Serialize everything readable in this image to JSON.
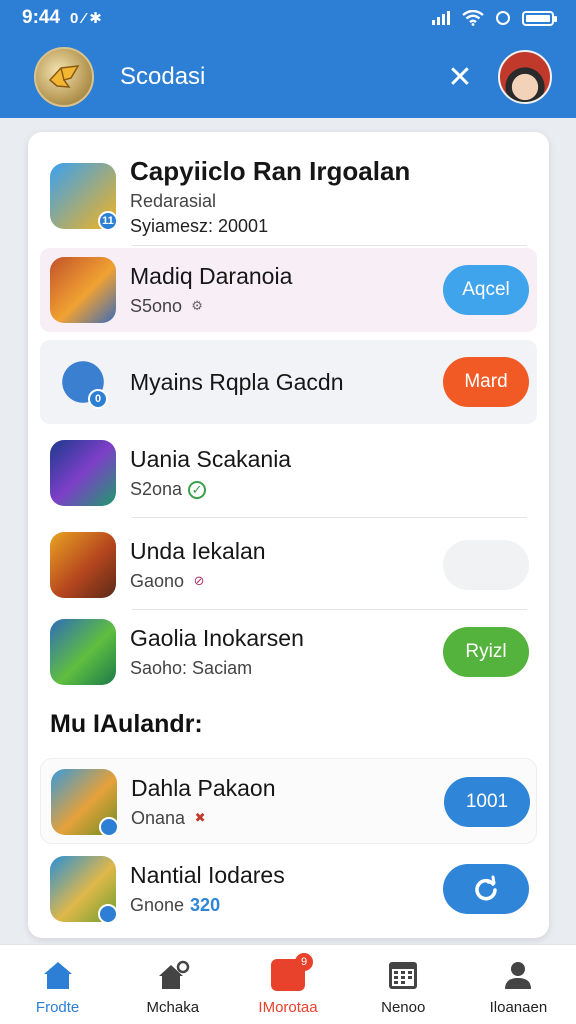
{
  "status_bar": {
    "time": "9:44",
    "left_glyphs": "0 ⁄ ✱"
  },
  "header": {
    "title": "Scodasi",
    "close_glyph": "✕"
  },
  "featured": {
    "title": "Capyiiclo Ran Irgoalan",
    "line1": "Redarasial",
    "line2": "Syiamesz: 20001",
    "icon_badge": "11"
  },
  "apps": [
    {
      "title": "Madiq Daranoia",
      "sub": "S5ono",
      "sub_icon": "⚙",
      "button": "Aqcel",
      "button_color": "#3fa4ec"
    },
    {
      "title": "Myains Rqpla Gacdn",
      "sub": "",
      "button": "Mard",
      "button_color": "#f15a24",
      "icon_badge": "0"
    },
    {
      "title": "Uania Scakania",
      "sub": "S2ona",
      "sub_icon": "✓",
      "button": ""
    },
    {
      "title": "Unda Iekalan",
      "sub": "Gaono",
      "sub_icon": "⊘",
      "button": "",
      "button_color": "#f1f2f4"
    },
    {
      "title": "Gaolia Inokarsen",
      "sub": "Saoho: Saciam",
      "button": "Ryizl",
      "button_color": "#54b33c"
    }
  ],
  "section": {
    "title": "Mu IAulandr:",
    "items": [
      {
        "title": "Dahla Pakaon",
        "sub": "Onana",
        "sub_icon": "✖",
        "button": "1001",
        "button_color": "#2f85d8"
      },
      {
        "title": "Nantial Iodares",
        "sub": "Gnone",
        "sub_extra": "320",
        "button_icon": "refresh-icon",
        "button_color": "#2f85d8"
      }
    ]
  },
  "bottom_nav": [
    {
      "label": "Frodte",
      "icon": "home-icon",
      "state": "active"
    },
    {
      "label": "Mchaka",
      "icon": "house-settings-icon",
      "state": "normal"
    },
    {
      "label": "IMorotaa",
      "icon": "gift-icon",
      "state": "hot",
      "badge": "9"
    },
    {
      "label": "Nenoo",
      "icon": "calendar-icon",
      "state": "normal"
    },
    {
      "label": "Iloanaen",
      "icon": "person-icon",
      "state": "normal"
    }
  ]
}
